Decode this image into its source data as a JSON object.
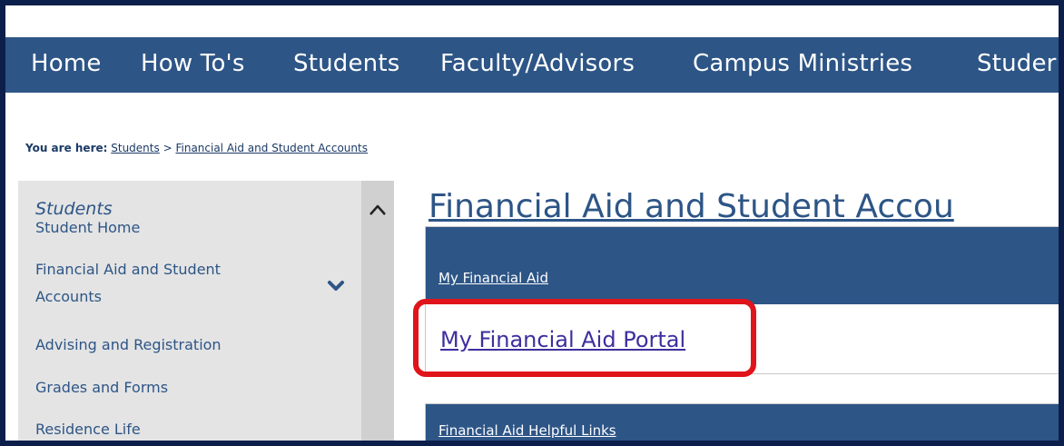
{
  "topnav": {
    "items": [
      "Home",
      "How To's",
      "Students",
      "Faculty/Advisors",
      "Campus Ministries",
      "Studer"
    ]
  },
  "breadcrumb": {
    "prefix": "You are here:",
    "link1": "Students",
    "separator": ">",
    "link2": "Financial Aid and Student Accounts"
  },
  "sidebar": {
    "title": "Students",
    "items": [
      "Student Home",
      "Financial Aid and Student",
      "Accounts",
      "Advising and Registration",
      "Grades and Forms",
      "Residence Life"
    ]
  },
  "main": {
    "title": "Financial Aid and Student Accou",
    "panels": [
      {
        "heading": "My Financial Aid",
        "link": "My Financial Aid Portal"
      },
      {
        "heading": "Financial Aid Helpful Links"
      }
    ]
  },
  "colors": {
    "nav_blue": "#2d5586",
    "highlight_red": "#e0141b",
    "frame_navy": "#0b1f4a"
  },
  "icons": [
    "chevron-down-icon",
    "chevron-up-icon"
  ]
}
